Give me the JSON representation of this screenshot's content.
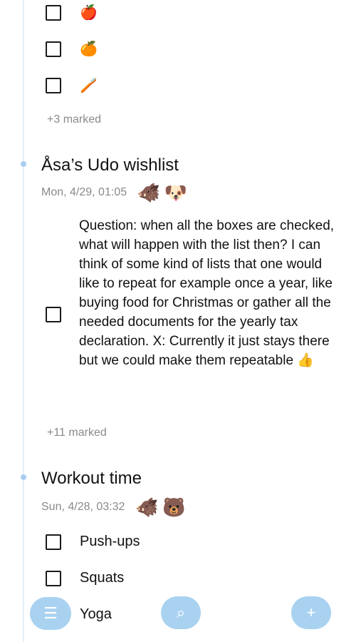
{
  "top_list": {
    "items": [
      {
        "emoji": "🍎",
        "icon": "apple-icon"
      },
      {
        "emoji": "🍊",
        "icon": "orange-icon"
      },
      {
        "emoji": "🪥",
        "icon": "toothbrush-icon"
      }
    ],
    "marked": "+3 marked"
  },
  "wishlist": {
    "title": "Åsa’s Udo wishlist",
    "date": "Mon, 4/29, 01:05",
    "avatars": [
      "🐗",
      "🐶"
    ],
    "item_text": "Question: when all the boxes are checked, what will happen with the list then? I can think of some kind of lists that one would like to repeat for example once a year, like buying food for Christmas or gather all the needed documents for the yearly tax declaration. X: Currently it just stays there but we could make them repeatable 👍",
    "marked": "+11 marked"
  },
  "workout": {
    "title": "Workout time",
    "date": "Sun, 4/28, 03:32",
    "avatars": [
      "🐗",
      "🐻"
    ],
    "items": [
      "Push-ups",
      "Squats",
      "Yoga"
    ]
  },
  "toolbar": {
    "menu_icon": "☰",
    "search_icon": "⌕",
    "add_icon": "+"
  },
  "colors": {
    "fab": "#a9d2f1",
    "timeline": "#e6eef6",
    "muted_text": "#8a8a8a"
  }
}
